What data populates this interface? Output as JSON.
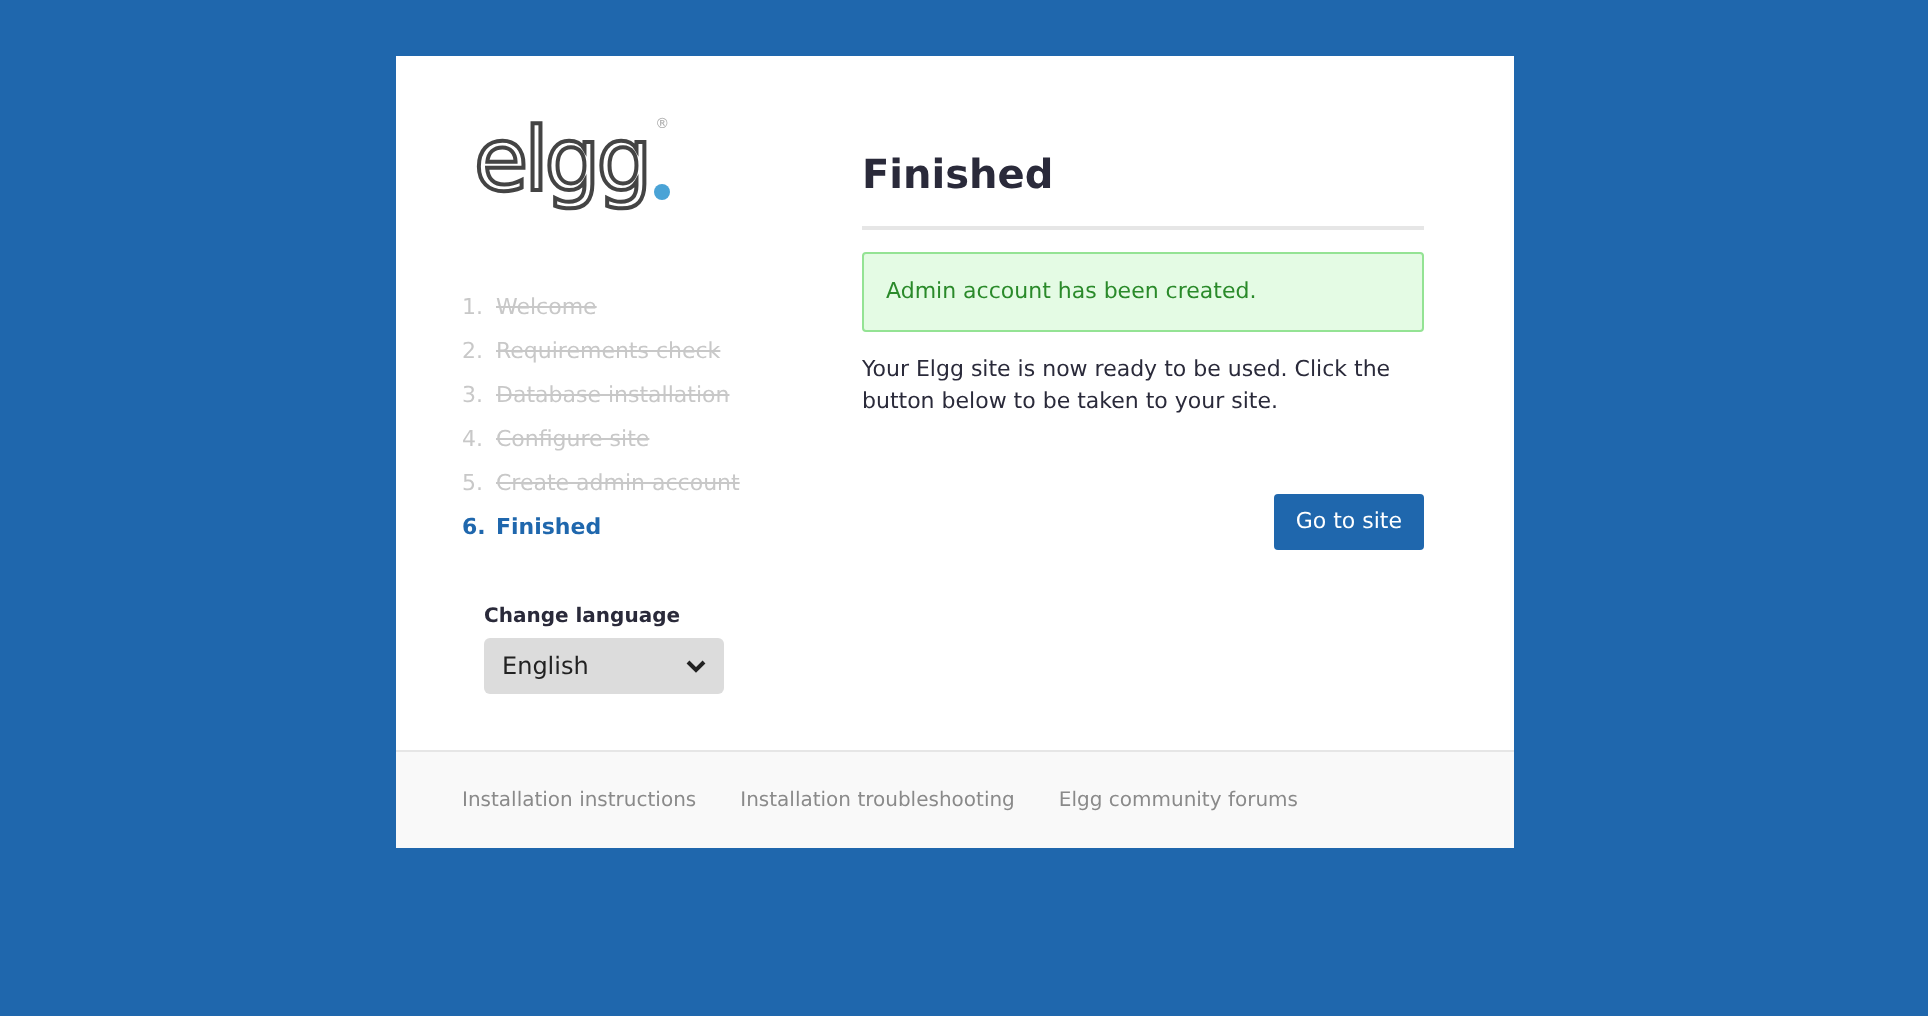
{
  "logo": {
    "text": "elgg",
    "mark": "®"
  },
  "steps": [
    {
      "number": "1.",
      "label": "Welcome",
      "completed": true,
      "selected": false
    },
    {
      "number": "2.",
      "label": "Requirements check",
      "completed": true,
      "selected": false
    },
    {
      "number": "3.",
      "label": "Database installation",
      "completed": true,
      "selected": false
    },
    {
      "number": "4.",
      "label": "Configure site",
      "completed": true,
      "selected": false
    },
    {
      "number": "5.",
      "label": "Create admin account",
      "completed": true,
      "selected": false
    },
    {
      "number": "6.",
      "label": "Finished",
      "completed": false,
      "selected": true
    }
  ],
  "language": {
    "label": "Change language",
    "value": "English"
  },
  "title": "Finished",
  "message": "Admin account has been created.",
  "body": "Your Elgg site is now ready to be used. Click the button below to be taken to your site.",
  "button": "Go to site",
  "footer_links": [
    "Installation instructions",
    "Installation troubleshooting",
    "Elgg community forums"
  ]
}
